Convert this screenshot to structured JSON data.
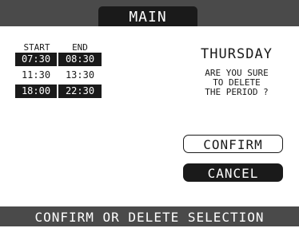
{
  "header": {
    "title": "MAIN"
  },
  "schedule": {
    "columns": {
      "start": "START",
      "end": "END"
    },
    "rows": [
      {
        "start": "07:30",
        "end": "08:30",
        "selected": true
      },
      {
        "start": "11:30",
        "end": "13:30",
        "selected": false
      },
      {
        "start": "18:00",
        "end": "22:30",
        "selected": true
      }
    ]
  },
  "dialog": {
    "day": "THURSDAY",
    "question_lines": [
      "ARE YOU SURE",
      "TO DELETE",
      "THE PERIOD ?"
    ],
    "confirm_label": "CONFIRM",
    "cancel_label": "CANCEL"
  },
  "footer": {
    "status": "CONFIRM OR DELETE SELECTION"
  },
  "colors": {
    "bar": "#4a4a4a",
    "dark": "#1a1a1a",
    "panel": "#ffffff"
  }
}
